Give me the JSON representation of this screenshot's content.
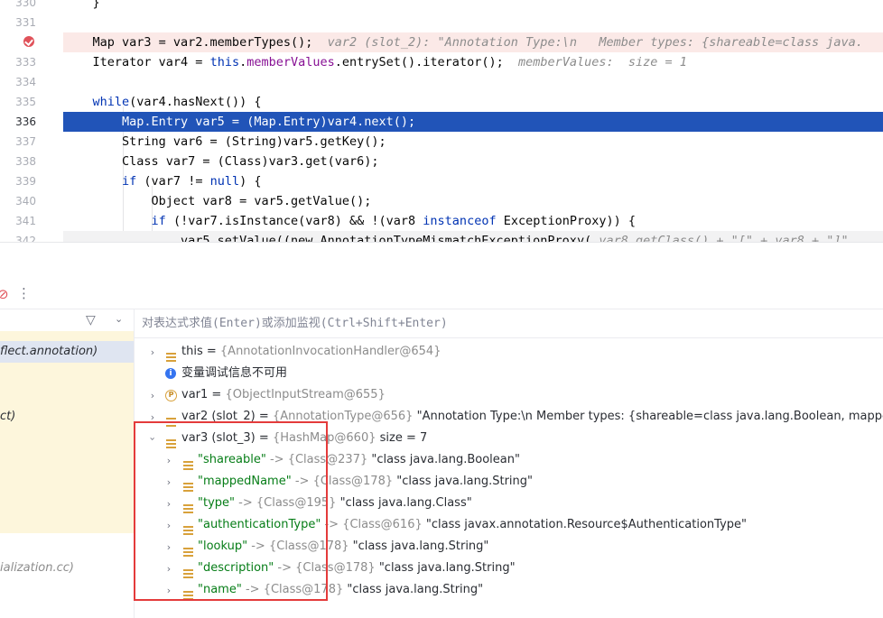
{
  "editor": {
    "lines": [
      {
        "num": "330",
        "code": "    }"
      },
      {
        "num": "331",
        "code": ""
      },
      {
        "num": "",
        "code": "    Map var3 = var2.memberTypes();",
        "hint": "var2 (slot_2): \"Annotation Type:\\n   Member types: {shareable=class java."
      },
      {
        "num": "333",
        "code_a": "    Iterator var4 = ",
        "code_kw": "this",
        "code_b": ".",
        "code_fld": "memberValues",
        "code_c": ".entrySet().iterator();",
        "hint": "memberValues:  size = 1"
      },
      {
        "num": "334",
        "code": ""
      },
      {
        "num": "335",
        "code_kw": "while",
        "code": "(var4.hasNext()) {"
      },
      {
        "num": "336",
        "code": "        Map.Entry var5 = (Map.Entry)var4.next();"
      },
      {
        "num": "337",
        "code": "        String var6 = (String)var5.getKey();"
      },
      {
        "num": "338",
        "code": "        Class var7 = (Class)var3.get(var6);"
      },
      {
        "num": "339",
        "code_kw": "if",
        "code": " (var7 != ",
        "code_kw2": "null",
        "code_end": ") {"
      },
      {
        "num": "340",
        "code": "            Object var8 = var5.getValue();"
      },
      {
        "num": "341",
        "code_kw": "if",
        "code": " (!var7.isInstance(var8) && !(var8 ",
        "code_kw2": "instanceof",
        "code_end": " ExceptionProxy)) {"
      },
      {
        "num": "342",
        "code": "                var5.setValue((new AnnotationTypeMismatchExceptionProxy(",
        "hint": "var8.getClass() + \"[\" + var8 + \"]\""
      }
    ]
  },
  "toolbar": {
    "more_icon": "more-vertical-icon",
    "filter_icon": "filter-icon",
    "dropdown_icon": "chevron-down-icon"
  },
  "frames": [
    {
      "label": "flect.annotation)"
    },
    {
      "label": "ct)"
    },
    {
      "label": "ialization.cc)"
    }
  ],
  "eval": {
    "placeholder": "对表达式求值(Enter)或添加监视(Ctrl+Shift+Enter)"
  },
  "variables": [
    {
      "name": "this",
      "sep": " = ",
      "type": "{AnnotationInvocationHandler@654}",
      "value": ""
    },
    {
      "info": "变量调试信息不可用"
    },
    {
      "name": "var1",
      "sep": " = ",
      "type": "{ObjectInputStream@655}",
      "value": ""
    },
    {
      "name": "var2 (slot_2)",
      "sep": " = ",
      "type": "{AnnotationType@656}",
      "value": "\"Annotation Type:\\n   Member types: {shareable=class java.lang.Boolean, mappedNam"
    },
    {
      "name": "var3 (slot_3)",
      "sep": " = ",
      "type": "{HashMap@660}",
      "value": "size = 7"
    }
  ],
  "entries": [
    {
      "key": "\"shareable\"",
      "arrow": " -> ",
      "type": "{Class@237}",
      "value": "\"class java.lang.Boolean\""
    },
    {
      "key": "\"mappedName\"",
      "arrow": " -> ",
      "type": "{Class@178}",
      "value": "\"class java.lang.String\""
    },
    {
      "key": "\"type\"",
      "arrow": " -> ",
      "type": "{Class@195}",
      "value": "\"class java.lang.Class\""
    },
    {
      "key": "\"authenticationType\"",
      "arrow": " -> ",
      "type": "{Class@616}",
      "value": "\"class javax.annotation.Resource$AuthenticationType\""
    },
    {
      "key": "\"lookup\"",
      "arrow": " -> ",
      "type": "{Class@178}",
      "value": "\"class java.lang.String\""
    },
    {
      "key": "\"description\"",
      "arrow": " -> ",
      "type": "{Class@178}",
      "value": "\"class java.lang.String\""
    },
    {
      "key": "\"name\"",
      "arrow": " -> ",
      "type": "{Class@178}",
      "value": "\"class java.lang.String\""
    }
  ],
  "colors": {
    "execution_line": "#2154b8",
    "breakpoint": "#e0525a",
    "highlight_box": "#e43b3b"
  }
}
